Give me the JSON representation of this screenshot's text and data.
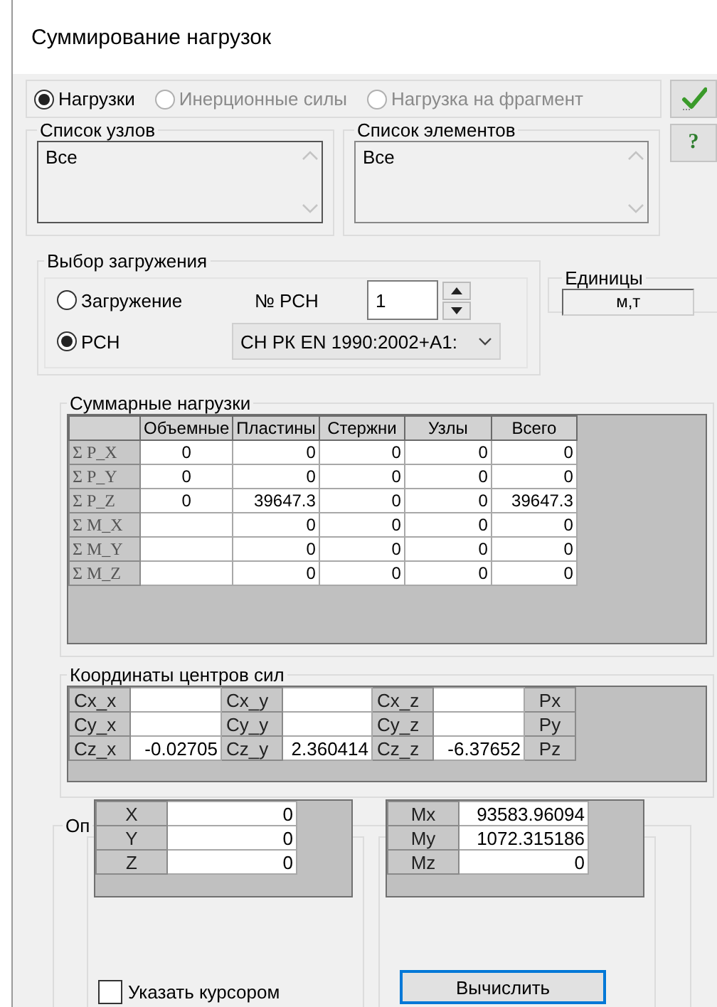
{
  "window": {
    "title": "Суммирование нагрузок"
  },
  "mode_options": [
    {
      "label": "Нагрузки",
      "selected": true,
      "disabled": false
    },
    {
      "label": "Инерционные силы",
      "selected": false,
      "disabled": true
    },
    {
      "label": "Нагрузка на фрагмент",
      "selected": false,
      "disabled": true
    }
  ],
  "side_buttons": [
    {
      "kind": "apply"
    },
    {
      "kind": "help",
      "label": "?"
    }
  ],
  "node_list": {
    "title": "Список узлов",
    "items": [
      "Все"
    ]
  },
  "element_list": {
    "title": "Список элементов",
    "items": [
      "Все"
    ]
  },
  "load_selection": {
    "title": "Выбор загружения",
    "options": [
      {
        "label": "Загружение",
        "selected": false
      },
      {
        "label": "РСН",
        "selected": true
      }
    ],
    "rsn_number_label": "№ РСН",
    "rsn_number": "1",
    "rsn_norm": "СН РК EN 1990:2002+A1:"
  },
  "units": {
    "title": "Единицы",
    "value": "м,т"
  },
  "sum_loads": {
    "title": "Суммарные нагрузки",
    "columns": [
      "Объемные",
      "Пластины",
      "Стержни",
      "Узлы",
      "Всего"
    ],
    "rows": [
      {
        "label": "Σ P_X",
        "cells": [
          "0",
          "0",
          "0",
          "0",
          "0"
        ]
      },
      {
        "label": "Σ P_Y",
        "cells": [
          "0",
          "0",
          "0",
          "0",
          "0"
        ]
      },
      {
        "label": "Σ P_Z",
        "cells": [
          "0",
          "39647.3",
          "0",
          "0",
          "39647.3"
        ]
      },
      {
        "label": "Σ M_X",
        "cells": [
          null,
          "0",
          "0",
          "0",
          "0"
        ]
      },
      {
        "label": "Σ M_Y",
        "cells": [
          null,
          "0",
          "0",
          "0",
          "0"
        ]
      },
      {
        "label": "Σ M_Z",
        "cells": [
          null,
          "0",
          "0",
          "0",
          "0"
        ]
      }
    ]
  },
  "force_centers": {
    "title": "Координаты центров сил",
    "rows": [
      {
        "cells": [
          {
            "label": "Cx_x"
          },
          {
            "label": "Cx_y"
          },
          {
            "label": "Cx_z"
          }
        ],
        "axis": "Px"
      },
      {
        "cells": [
          {
            "label": "Cy_x"
          },
          {
            "label": "Cy_y"
          },
          {
            "label": "Cy_z"
          }
        ],
        "axis": "Py"
      },
      {
        "cells": [
          {
            "label": "Cz_x",
            "value": "-0.02705"
          },
          {
            "label": "Cz_y",
            "value": "2.360414"
          },
          {
            "label": "Cz_z",
            "value": "-6.37652"
          }
        ],
        "axis": "Pz"
      }
    ]
  },
  "bottom": {
    "title": "Оп",
    "coordinates": [
      {
        "label": "X",
        "value": "0"
      },
      {
        "label": "Y",
        "value": "0"
      },
      {
        "label": "Z",
        "value": "0"
      }
    ],
    "moments": [
      {
        "label": "Mx",
        "value": "93583.96094"
      },
      {
        "label": "My",
        "value": "1072.315186"
      },
      {
        "label": "Mz",
        "value": "0"
      }
    ],
    "cursor_checkbox": {
      "label": "Указать курсором",
      "checked": false
    },
    "calculate_button": "Вычислить"
  }
}
